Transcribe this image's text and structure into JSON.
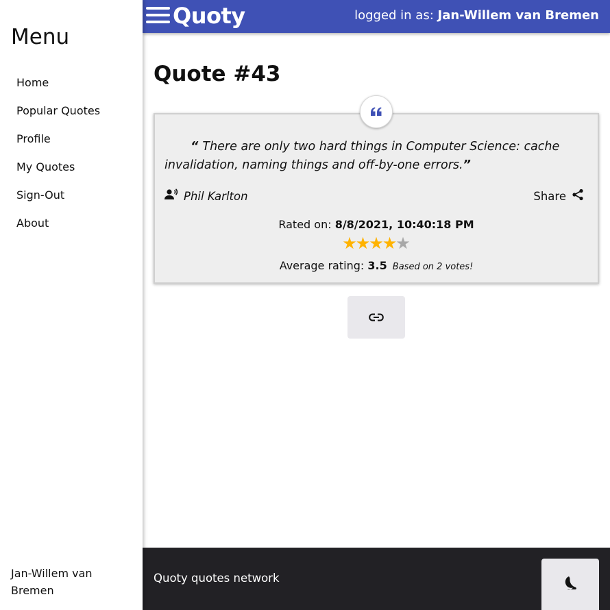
{
  "app": {
    "name": "Quoty",
    "logged_in_label": "logged in as:",
    "logged_in_user": "Jan-Willem van Bremen"
  },
  "sidebar": {
    "title": "Menu",
    "items": [
      {
        "label": "Home"
      },
      {
        "label": "Popular Quotes"
      },
      {
        "label": "Profile"
      },
      {
        "label": "My Quotes"
      },
      {
        "label": "Sign-Out"
      },
      {
        "label": "About"
      }
    ],
    "user": "Jan-Willem van Bremen"
  },
  "main": {
    "title": "Quote #43",
    "quote": {
      "text": "There are only two hard things in Computer Science: cache invalidation, naming things and off-by-one errors.",
      "author": "Phil Karlton",
      "share_label": "Share",
      "rated_label": "Rated on:",
      "rated_date": "8/8/2021, 10:40:18 PM",
      "rating": 3.5,
      "stars_total": 5,
      "stars_filled": 4,
      "avg_label": "Average rating:",
      "avg_value": "3.5",
      "votes_note": "Based on 2 votes!"
    }
  },
  "footer": {
    "text": "Quoty quotes network"
  },
  "icons": {
    "badge": "quote-icon",
    "author": "speaker-icon",
    "share": "share-icon",
    "link": "link-icon",
    "theme": "moon-icon",
    "menu": "hamburger-icon"
  },
  "colors": {
    "header": "#3f51b5",
    "card": "#eeeeee",
    "star": "#ffb300",
    "star_empty": "#a8a8a8",
    "footer": "#222125"
  }
}
